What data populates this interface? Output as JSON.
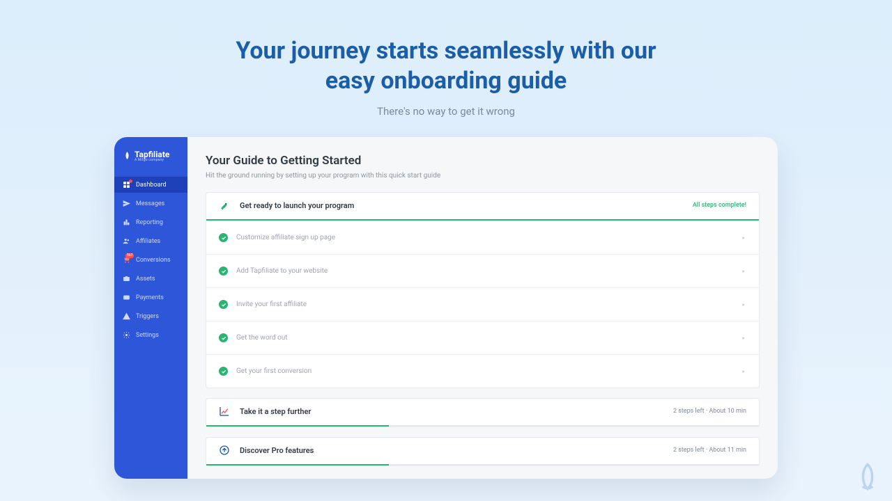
{
  "hero": {
    "title_line1": "Your journey starts seamlessly with our",
    "title_line2": "easy onboarding guide",
    "subtitle": "There's no way to get it wrong"
  },
  "brand": {
    "name": "Tapfiliate",
    "tagline": "A Mitgo company"
  },
  "sidebar": {
    "items": [
      {
        "label": "Dashboard",
        "icon": "grid-icon",
        "active": true,
        "dot": true
      },
      {
        "label": "Messages",
        "icon": "send-icon"
      },
      {
        "label": "Reporting",
        "icon": "chart-icon"
      },
      {
        "label": "Affiliates",
        "icon": "users-icon"
      },
      {
        "label": "Conversions",
        "icon": "cart-icon",
        "pill": "563"
      },
      {
        "label": "Assets",
        "icon": "briefcase-icon"
      },
      {
        "label": "Payments",
        "icon": "wallet-icon"
      },
      {
        "label": "Triggers",
        "icon": "warning-icon"
      },
      {
        "label": "Settings",
        "icon": "gear-icon"
      }
    ]
  },
  "main": {
    "title": "Your Guide to Getting Started",
    "subtitle": "Hit the ground running by setting up your program with this quick start guide"
  },
  "sections": {
    "launch": {
      "title": "Get ready to launch your program",
      "status": "All steps complete!",
      "progress_pct": 100,
      "steps": [
        "Customize affiliate sign up page",
        "Add Tapfiliate to your website",
        "Invite your first affiliate",
        "Get the word out",
        "Get your first conversion"
      ]
    },
    "further": {
      "title": "Take it a step further",
      "meta": "2 steps left · About 10 min",
      "progress_pct": 33
    },
    "pro": {
      "title": "Discover Pro features",
      "meta": "2 steps left · About 11 min",
      "progress_pct": 33
    }
  }
}
